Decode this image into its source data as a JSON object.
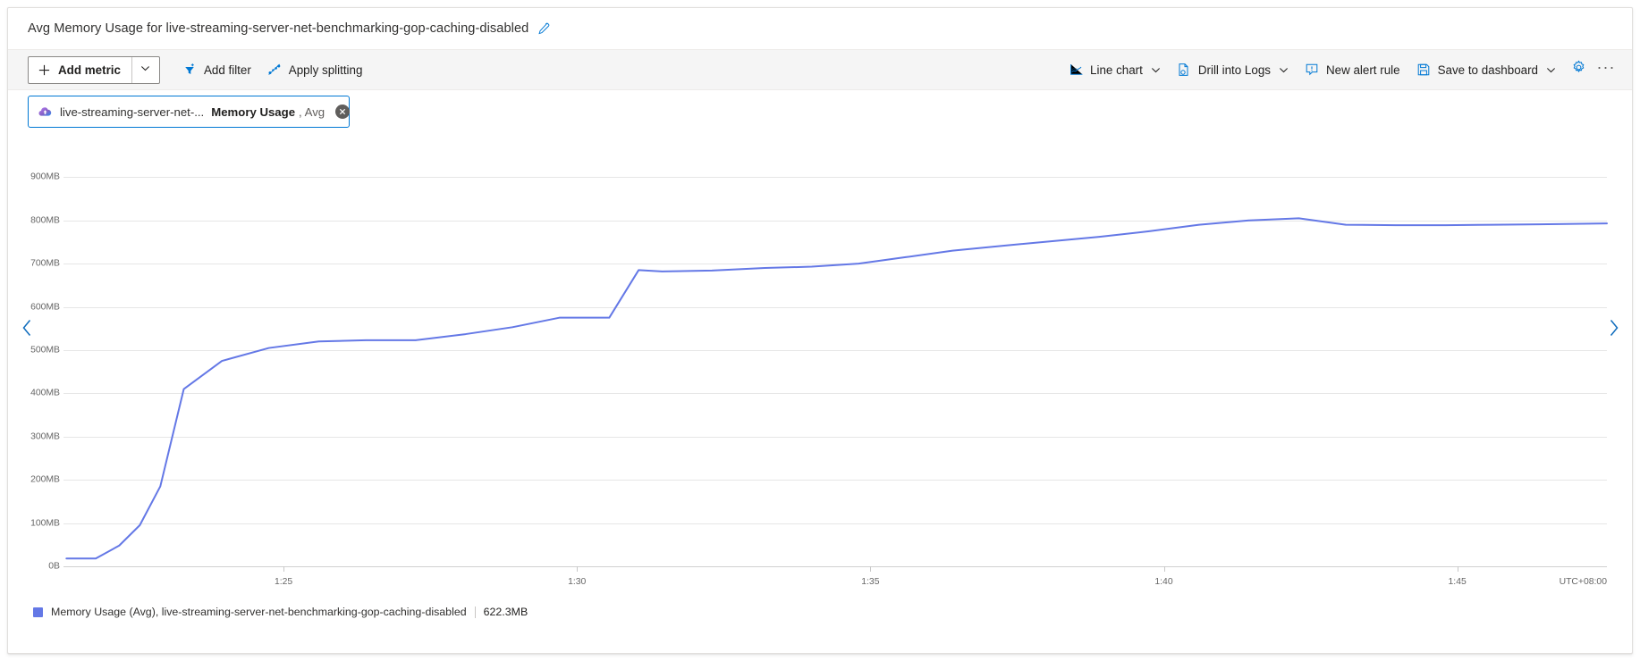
{
  "header": {
    "title": "Avg Memory Usage for live-streaming-server-net-benchmarking-gop-caching-disabled",
    "edit_icon": "pencil-icon"
  },
  "toolbar": {
    "add_metric_label": "Add metric",
    "add_metric_icon": "plus-icon",
    "add_metric_caret_icon": "chevron-down-icon",
    "add_filter_label": "Add filter",
    "add_filter_icon": "filter-icon",
    "apply_splitting_label": "Apply splitting",
    "apply_splitting_icon": "splitting-icon",
    "chart_type_label": "Line chart",
    "chart_type_icon": "line-chart-icon",
    "chart_type_caret_icon": "chevron-down-icon",
    "drill_logs_label": "Drill into Logs",
    "drill_logs_icon": "logs-icon",
    "drill_logs_caret_icon": "chevron-down-icon",
    "new_alert_label": "New alert rule",
    "new_alert_icon": "alert-bell-icon",
    "save_dashboard_label": "Save to dashboard",
    "save_dashboard_icon": "save-disk-icon",
    "save_dashboard_caret_icon": "chevron-down-icon",
    "settings_icon": "gear-icon",
    "more_icon": "ellipsis-icon",
    "more_label": "···"
  },
  "metric_chip": {
    "resource_icon": "streaming-endpoint-icon",
    "resource_name": "live-streaming-server-net-...",
    "metric_name": "Memory Usage",
    "aggregation": ", Avg",
    "close_icon": "close-circle-icon"
  },
  "navigation": {
    "prev_icon": "chevron-left-icon",
    "next_icon": "chevron-right-icon"
  },
  "legend": {
    "color": "#6478e6",
    "text": "Memory Usage (Avg), live-streaming-server-net-benchmarking-gop-caching-disabled",
    "value": "622.3MB"
  },
  "chart_data": {
    "type": "line",
    "title": "Avg Memory Usage for live-streaming-server-net-benchmarking-gop-caching-disabled",
    "xlabel": "",
    "ylabel": "",
    "timezone": "UTC+08:00",
    "grid": true,
    "legend_position": "bottom",
    "line_color": "#6478e6",
    "ylim": [
      0,
      940
    ],
    "yunit": "MB",
    "yticks": [
      0,
      100,
      200,
      300,
      400,
      500,
      600,
      700,
      800,
      900
    ],
    "ytick_labels": [
      "0B",
      "100MB",
      "200MB",
      "300MB",
      "400MB",
      "500MB",
      "600MB",
      "700MB",
      "800MB",
      "900MB"
    ],
    "xticks": [
      1.25,
      1.3,
      1.35,
      1.4,
      1.45
    ],
    "xtick_labels": [
      "1:25",
      "1:30",
      "1:35",
      "1:40",
      "1:45"
    ],
    "xlim": [
      1.2125,
      1.4755
    ],
    "series": [
      {
        "name": "Memory Usage (Avg), live-streaming-server-net-benchmarking-gop-caching-disabled",
        "current_value": "622.3MB",
        "x": [
          1.213,
          1.218,
          1.222,
          1.2255,
          1.229,
          1.233,
          1.2395,
          1.2475,
          1.256,
          1.264,
          1.2725,
          1.281,
          1.289,
          1.297,
          1.3055,
          1.3105,
          1.3145,
          1.323,
          1.332,
          1.34,
          1.348,
          1.356,
          1.364,
          1.373,
          1.381,
          1.389,
          1.3975,
          1.406,
          1.4145,
          1.423,
          1.431,
          1.4395,
          1.448,
          1.456,
          1.464,
          1.4755
        ],
        "y": [
          18,
          18,
          48,
          95,
          185,
          410,
          475,
          505,
          520,
          523,
          523,
          537,
          553,
          575,
          575,
          685,
          682,
          684,
          690,
          693,
          700,
          715,
          730,
          742,
          752,
          762,
          775,
          790,
          800,
          805,
          790,
          789,
          789,
          790,
          791,
          793
        ]
      }
    ]
  }
}
